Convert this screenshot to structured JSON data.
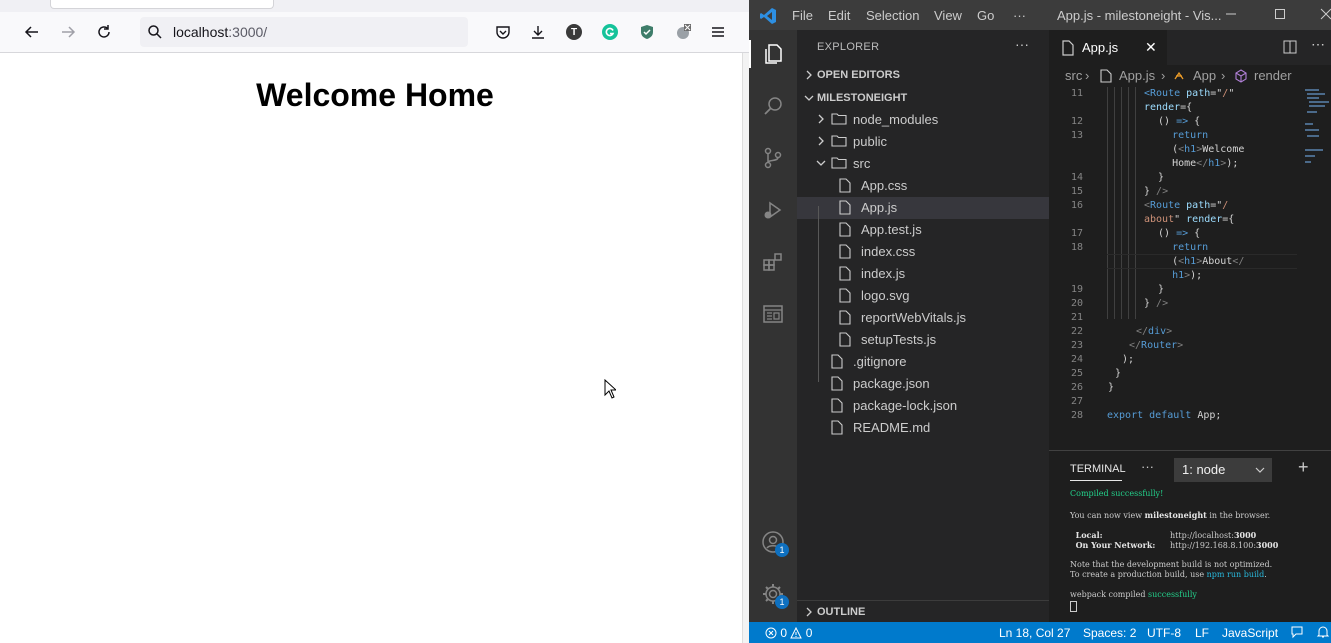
{
  "browser": {
    "url_host": "localhost",
    "url_port": ":3000/",
    "extension_tor_letter": "T",
    "page_heading": "Welcome Home"
  },
  "vscode": {
    "menus": [
      "File",
      "Edit",
      "Selection",
      "View",
      "Go",
      "···"
    ],
    "window_title": "App.js - milestoneight - Vis...",
    "activity_badges": {
      "accounts": "1",
      "manage": "1"
    },
    "explorer": {
      "title": "EXPLORER",
      "more": "···",
      "open_editors": "OPEN EDITORS",
      "project": "MILESTONEIGHT",
      "outline": "OUTLINE",
      "tree": [
        {
          "name": "node_modules",
          "type": "folder",
          "state": "collapsed",
          "depth": 1
        },
        {
          "name": "public",
          "type": "folder",
          "state": "collapsed",
          "depth": 1
        },
        {
          "name": "src",
          "type": "folder",
          "state": "expanded",
          "depth": 1
        },
        {
          "name": "App.css",
          "type": "file",
          "depth": 2
        },
        {
          "name": "App.js",
          "type": "file",
          "depth": 2,
          "selected": true
        },
        {
          "name": "App.test.js",
          "type": "file",
          "depth": 2
        },
        {
          "name": "index.css",
          "type": "file",
          "depth": 2
        },
        {
          "name": "index.js",
          "type": "file",
          "depth": 2
        },
        {
          "name": "logo.svg",
          "type": "file",
          "depth": 2
        },
        {
          "name": "reportWebVitals.js",
          "type": "file",
          "depth": 2
        },
        {
          "name": "setupTests.js",
          "type": "file",
          "depth": 2
        },
        {
          "name": ".gitignore",
          "type": "file",
          "depth": 1
        },
        {
          "name": "package.json",
          "type": "file",
          "depth": 1
        },
        {
          "name": "package-lock.json",
          "type": "file",
          "depth": 1
        },
        {
          "name": "README.md",
          "type": "file",
          "depth": 1
        }
      ]
    },
    "editor": {
      "tab_label": "App.js",
      "breadcrumb": [
        "src",
        "App.js",
        "App",
        "render"
      ],
      "lines": [
        {
          "n": "11",
          "segs": [
            [
              "tag",
              "<Route "
            ],
            [
              "attr",
              "path"
            ],
            [
              "tx",
              "=\""
            ],
            [
              "str",
              "/"
            ],
            [
              "tx",
              "\""
            ]
          ]
        },
        {
          "n": "",
          "segs": [
            [
              "attr",
              "render"
            ],
            [
              "tx",
              "={"
            ]
          ]
        },
        {
          "n": "12",
          "segs": [
            [
              "tx",
              "  () "
            ],
            [
              "kw",
              "=>"
            ],
            [
              "tx",
              " {"
            ]
          ]
        },
        {
          "n": "13",
          "segs": [
            [
              "kw",
              "    return"
            ]
          ]
        },
        {
          "n": "",
          "segs": [
            [
              "tx",
              "    ("
            ],
            [
              "punc",
              "<"
            ],
            [
              "tag",
              "h1"
            ],
            [
              "punc",
              ">"
            ],
            [
              "tx",
              "Welcome"
            ]
          ]
        },
        {
          "n": "",
          "segs": [
            [
              "tx",
              "    Home"
            ],
            [
              "punc",
              "</"
            ],
            [
              "tag",
              "h1"
            ],
            [
              "punc",
              ">"
            ],
            [
              "tx",
              ");"
            ]
          ]
        },
        {
          "n": "14",
          "segs": [
            [
              "tx",
              "  }"
            ]
          ]
        },
        {
          "n": "15",
          "segs": [
            [
              "tx",
              "} "
            ],
            [
              "punc",
              "/>"
            ]
          ]
        },
        {
          "n": "16",
          "segs": [
            [
              "punc",
              "<"
            ],
            [
              "tag",
              "Route "
            ],
            [
              "attr",
              "path"
            ],
            [
              "tx",
              "=\""
            ],
            [
              "str",
              "/"
            ]
          ]
        },
        {
          "n": "",
          "segs": [
            [
              "str",
              "about"
            ],
            [
              "tx",
              "\" "
            ],
            [
              "attr",
              "render"
            ],
            [
              "tx",
              "={"
            ]
          ]
        },
        {
          "n": "17",
          "segs": [
            [
              "tx",
              "  () "
            ],
            [
              "kw",
              "=>"
            ],
            [
              "tx",
              " {"
            ]
          ]
        },
        {
          "n": "18",
          "segs": [
            [
              "kw",
              "    return"
            ]
          ]
        },
        {
          "n": "",
          "segs": [
            [
              "tx",
              "    ("
            ],
            [
              "punc",
              "<"
            ],
            [
              "tag",
              "h1"
            ],
            [
              "punc",
              ">"
            ],
            [
              "tx",
              "About"
            ],
            [
              "punc",
              "</"
            ]
          ]
        },
        {
          "n": "",
          "segs": [
            [
              "tag",
              "    h1"
            ],
            [
              "punc",
              ">"
            ],
            [
              "tx",
              ");"
            ]
          ]
        },
        {
          "n": "19",
          "segs": [
            [
              "tx",
              "  }"
            ]
          ]
        },
        {
          "n": "20",
          "segs": [
            [
              "tx",
              "} "
            ],
            [
              "punc",
              "/>"
            ]
          ]
        },
        {
          "n": "21",
          "segs": []
        },
        {
          "n": "22",
          "segs": [
            [
              "punc",
              "</"
            ],
            [
              "tag",
              "div"
            ],
            [
              "punc",
              ">"
            ]
          ]
        },
        {
          "n": "23",
          "segs": [
            [
              "punc",
              "</"
            ],
            [
              "tag",
              "Router"
            ],
            [
              "punc",
              ">"
            ]
          ]
        },
        {
          "n": "24",
          "segs": [
            [
              "tx",
              ");"
            ]
          ]
        },
        {
          "n": "25",
          "segs": [
            [
              "tx",
              "}"
            ]
          ]
        },
        {
          "n": "26",
          "segs": [
            [
              "tx",
              "}"
            ]
          ]
        },
        {
          "n": "27",
          "segs": []
        },
        {
          "n": "28",
          "segs": [
            [
              "kw",
              "export "
            ],
            [
              "kw",
              "default "
            ],
            [
              "tx",
              "App;"
            ]
          ]
        }
      ]
    },
    "terminal": {
      "tab": "TERMINAL",
      "more": "···",
      "selected_shell": "1: node",
      "compiled": "Compiled successfully!",
      "view_pre": "You can now view ",
      "view_app": "milestoneight",
      "view_post": " in the browser.",
      "local_label": "  Local:",
      "local_pre": "http://localhost:",
      "local_port": "3000",
      "network_label": "  On Your Network:",
      "network_pre": "http://192.168.8.100:",
      "network_port": "3000",
      "note1": "Note that the development build is not optimized.",
      "note2_pre": "To create a production build, use ",
      "note2_cmd": "npm run build",
      "note2_post": ".",
      "webpack_pre": "webpack compiled ",
      "webpack_ok": "successfully"
    },
    "status": {
      "errors": "0",
      "warnings": "0",
      "position": "Ln 18, Col 27",
      "spaces": "Spaces: 2",
      "encoding": "UTF-8",
      "eol": "LF",
      "language": "JavaScript"
    },
    "colors": {
      "accent": "#007acc",
      "activity": "#333333",
      "sidebar": "#252526",
      "editor": "#1e1e1e"
    }
  }
}
